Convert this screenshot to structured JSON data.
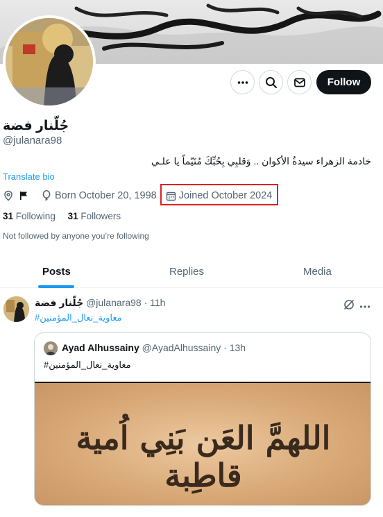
{
  "profile": {
    "display_name": "جُلّنار فضة",
    "handle": "@julanara98",
    "bio": "خادمة الزهراء سيدةُ الأكوان .. وَقلبِي بِحُبِّكَ مُتَيّماً  يا علـي",
    "translate_bio": "Translate bio",
    "born": "Born October 20, 1998",
    "joined": "Joined October 2024",
    "following_count": "31",
    "following_label": "Following",
    "followers_count": "31",
    "followers_label": "Followers",
    "not_followed": "Not followed by anyone you’re following"
  },
  "actions": {
    "follow_label": "Follow"
  },
  "tabs": [
    {
      "label": "Posts",
      "active": true
    },
    {
      "label": "Replies",
      "active": false
    },
    {
      "label": "Media",
      "active": false
    }
  ],
  "post": {
    "author_name": "جُلّنار فضة",
    "author_handle": "@julanara98",
    "time": "11h",
    "hashtag": "#معاوية_نعال_المؤمنين",
    "quote": {
      "author_name": "Ayad Alhussainy",
      "author_handle": "@AyadAlhussainy",
      "time": "13h",
      "text": "#معاوية_نعال_المؤمنين",
      "image_text": "اللهمَّ العَن بَنِي اُمية قاطِبة"
    }
  },
  "icons": {
    "more": "more-horizontal-icon",
    "search": "search-icon",
    "message": "envelope-icon",
    "location": "location-pin-icon",
    "flag": "flag-icon",
    "balloon": "balloon-icon",
    "calendar": "calendar-icon",
    "grok": "grok-icon"
  },
  "colors": {
    "accent": "#1d9bf0",
    "text_primary": "#0f1419",
    "text_secondary": "#536471",
    "highlight_box": "#e02020"
  }
}
